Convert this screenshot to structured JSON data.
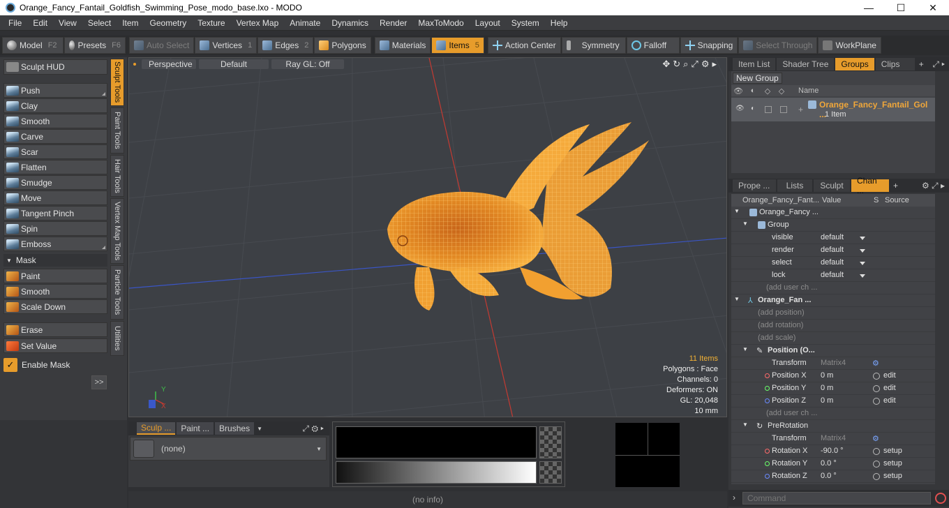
{
  "window": {
    "title": "Orange_Fancy_Fantail_Goldfish_Swimming_Pose_modo_base.lxo - MODO",
    "minimize": "—",
    "maximize": "☐",
    "close": "✕"
  },
  "menu": [
    "File",
    "Edit",
    "View",
    "Select",
    "Item",
    "Geometry",
    "Texture",
    "Vertex Map",
    "Animate",
    "Dynamics",
    "Render",
    "MaxToModo",
    "Layout",
    "System",
    "Help"
  ],
  "toolbar": {
    "model": "Model",
    "model_key": "F2",
    "presets": "Presets",
    "presets_key": "F6",
    "auto_select": "Auto Select",
    "vertices": "Vertices",
    "vertices_key": "1",
    "edges": "Edges",
    "edges_key": "2",
    "polygons": "Polygons",
    "materials": "Materials",
    "items": "Items",
    "items_key": "5",
    "action_center": "Action Center",
    "symmetry": "Symmetry",
    "falloff": "Falloff",
    "snapping": "Snapping",
    "select_through": "Select Through",
    "workplane": "WorkPlane"
  },
  "sculpt": {
    "hud": "Sculpt HUD",
    "tools": [
      "Push",
      "Clay",
      "Smooth",
      "Carve",
      "Scar",
      "Flatten",
      "Smudge",
      "Move",
      "Tangent Pinch",
      "Spin",
      "Emboss"
    ],
    "mask_section": "Mask",
    "mask_tools": [
      "Paint",
      "Smooth",
      "Scale Down"
    ],
    "erase": "Erase",
    "set_value": "Set Value",
    "enable_mask": "Enable Mask",
    "more": ">>"
  },
  "vtabs": [
    "Sculpt Tools",
    "Paint Tools",
    "Hair Tools",
    "Vertex Map Tools",
    "Particle Tools",
    "Utilities"
  ],
  "viewport": {
    "perspective": "Perspective",
    "default": "Default",
    "raygl": "Ray GL: Off",
    "hud": {
      "items": "11 Items",
      "polygons": "Polygons : Face",
      "channels": "Channels: 0",
      "deformers": "Deformers: ON",
      "gl": "GL: 20,048",
      "scale": "10 mm"
    },
    "axis_y": "Y",
    "axis_x": "X"
  },
  "bottom": {
    "tab1": "Sculp ...",
    "tab2": "Paint ...",
    "tab3": "Brushes",
    "preset": "(none)"
  },
  "status": "(no info)",
  "right": {
    "top_tabs": [
      "Item List",
      "Shader Tree",
      "Groups",
      "Clips"
    ],
    "new_group": "New Group",
    "name_header": "Name",
    "group_name": "Orange_Fancy_Fantail_Gol ...",
    "group_count": "1 Item",
    "mid_tabs": [
      "Prope ...",
      "Lists",
      "Sculpt",
      "Chan ..."
    ],
    "chan_headers": {
      "name": "Orange_Fancy_Fant...",
      "value": "Value",
      "s": "S",
      "source": "Source"
    },
    "rows": [
      {
        "name": "Orange_Fancy ...",
        "value": "",
        "src": ""
      },
      {
        "name": "Group",
        "value": "",
        "src": ""
      },
      {
        "name": "visible",
        "value": "default",
        "src": ""
      },
      {
        "name": "render",
        "value": "default",
        "src": ""
      },
      {
        "name": "select",
        "value": "default",
        "src": ""
      },
      {
        "name": "lock",
        "value": "default",
        "src": ""
      },
      {
        "name": "(add user ch ...",
        "value": "",
        "src": ""
      },
      {
        "name": "Orange_Fan ...",
        "value": "",
        "src": ""
      },
      {
        "name": "(add position)",
        "value": "",
        "src": ""
      },
      {
        "name": "(add rotation)",
        "value": "",
        "src": ""
      },
      {
        "name": "(add scale)",
        "value": "",
        "src": ""
      },
      {
        "name": "Position (O...",
        "value": "",
        "src": ""
      },
      {
        "name": "Transform",
        "value": "Matrix4",
        "src": ""
      },
      {
        "name": "Position X",
        "value": "0 m",
        "src": "edit"
      },
      {
        "name": "Position Y",
        "value": "0 m",
        "src": "edit"
      },
      {
        "name": "Position Z",
        "value": "0 m",
        "src": "edit"
      },
      {
        "name": "(add user ch ...",
        "value": "",
        "src": ""
      },
      {
        "name": "PreRotation",
        "value": "",
        "src": ""
      },
      {
        "name": "Transform",
        "value": "Matrix4",
        "src": ""
      },
      {
        "name": "Rotation X",
        "value": "-90.0 °",
        "src": "setup"
      },
      {
        "name": "Rotation Y",
        "value": "0.0 °",
        "src": "setup"
      },
      {
        "name": "Rotation Z",
        "value": "0.0 °",
        "src": "setup"
      }
    ],
    "command_placeholder": "Command"
  },
  "colors": {
    "accent": "#e79c2b",
    "fish": "#f3a236"
  }
}
